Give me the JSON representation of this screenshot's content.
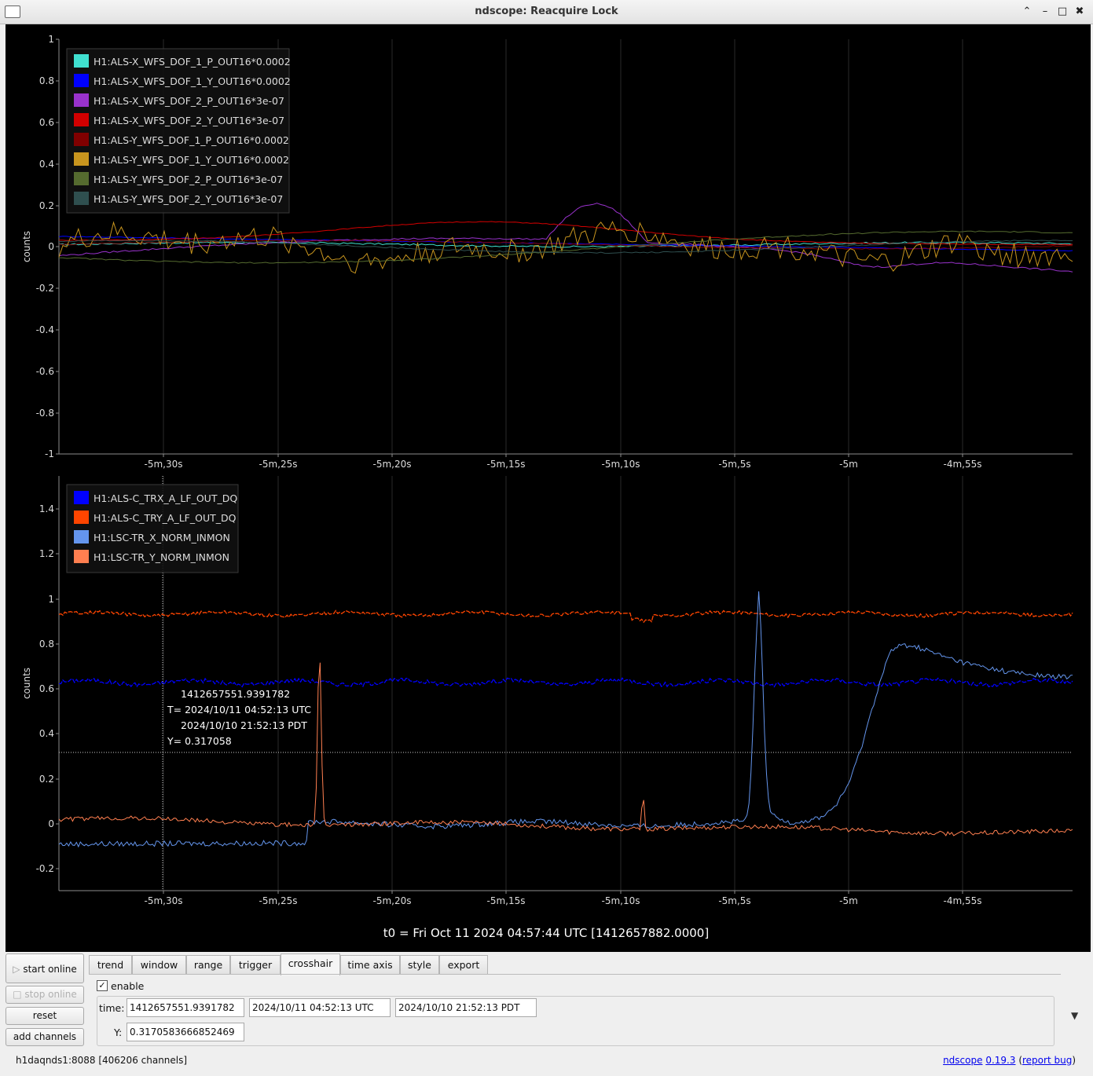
{
  "window": {
    "title": "ndscope: Reacquire Lock",
    "btn_min": "⌃",
    "btn_minimize": "–",
    "btn_max": "□",
    "btn_close": "✖"
  },
  "colors": {
    "plot_bg": "#000000",
    "grid": "#2a2a2a",
    "axis": "#8c8c8c",
    "text": "#dddddd"
  },
  "plot1": {
    "ylabel": "counts",
    "yticks": [
      "1",
      "0.8",
      "0.6",
      "0.4",
      "0.2",
      "0",
      "-0.2",
      "-0.4",
      "-0.6",
      "-0.8",
      "-1"
    ],
    "legend": [
      {
        "label": "H1:ALS-X_WFS_DOF_1_P_OUT16*0.0002",
        "color": "#40e0d0"
      },
      {
        "label": "H1:ALS-X_WFS_DOF_1_Y_OUT16*0.0002",
        "color": "#0000ff"
      },
      {
        "label": "H1:ALS-X_WFS_DOF_2_P_OUT16*3e-07",
        "color": "#9932cc"
      },
      {
        "label": "H1:ALS-X_WFS_DOF_2_Y_OUT16*3e-07",
        "color": "#d20000"
      },
      {
        "label": "H1:ALS-Y_WFS_DOF_1_P_OUT16*0.0002",
        "color": "#800000"
      },
      {
        "label": "H1:ALS-Y_WFS_DOF_1_Y_OUT16*0.0002",
        "color": "#c8951e"
      },
      {
        "label": "H1:ALS-Y_WFS_DOF_2_P_OUT16*3e-07",
        "color": "#556b2f"
      },
      {
        "label": "H1:ALS-Y_WFS_DOF_2_Y_OUT16*3e-07",
        "color": "#2f4f4f"
      }
    ]
  },
  "plot2": {
    "ylabel": "counts",
    "yticks": [
      "1.4",
      "1.2",
      "1",
      "0.8",
      "0.6",
      "0.4",
      "0.2",
      "0",
      "-0.2"
    ],
    "legend": [
      {
        "label": "H1:ALS-C_TRX_A_LF_OUT_DQ",
        "color": "#0000ff"
      },
      {
        "label": "H1:ALS-C_TRY_A_LF_OUT_DQ",
        "color": "#ff4500"
      },
      {
        "label": "H1:LSC-TR_X_NORM_INMON",
        "color": "#6495ed"
      },
      {
        "label": "H1:LSC-TR_Y_NORM_INMON",
        "color": "#ff7f50"
      }
    ],
    "crosshair_lines": [
      "1412657551.9391782",
      "T= 2024/10/11 04:52:13 UTC",
      "2024/10/10 21:52:13 PDT",
      "Y= 0.317058"
    ]
  },
  "xticks": [
    "-5m,30s",
    "-5m,25s",
    "-5m,20s",
    "-5m,15s",
    "-5m,10s",
    "-5m,5s",
    "-5m",
    "-4m,55s"
  ],
  "t0": "t0 = Fri Oct 11 2024 04:57:44 UTC [1412657882.0000]",
  "buttons": {
    "start_online": "start online",
    "stop_online": "stop online",
    "reset": "reset",
    "add_channels": "add channels"
  },
  "tabs": [
    "trend",
    "window",
    "range",
    "trigger",
    "crosshair",
    "time axis",
    "style",
    "export"
  ],
  "active_tab": "crosshair",
  "crosshair": {
    "enable_label": "enable",
    "enable_checked": "✓",
    "time_label": "time:",
    "y_label": "Y:",
    "time_gps": "1412657551.9391782",
    "time_utc": "2024/10/11 04:52:13 UTC",
    "time_pdt": "2024/10/10 21:52:13 PDT",
    "y_value": "0.3170583666852469",
    "dropdown_arrow": "▼"
  },
  "status": {
    "server": "h1daqnds1:8088  [406206 channels]",
    "ndscope_link": "ndscope",
    "version_link": "0.19.3",
    "report_link": "report bug"
  }
}
